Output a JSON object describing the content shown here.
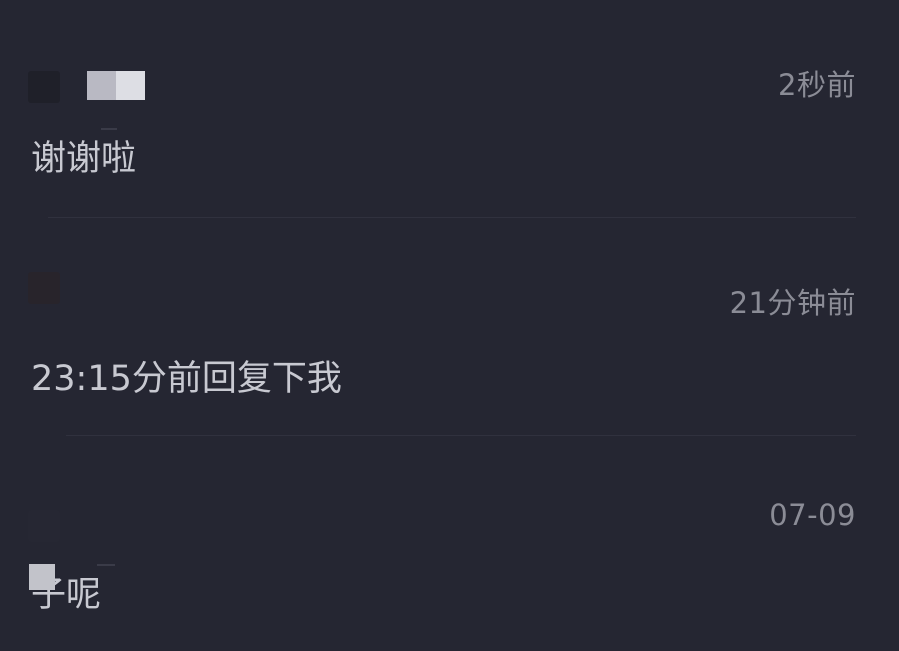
{
  "notifications": [
    {
      "time": "2秒前",
      "message": "谢谢啦"
    },
    {
      "time": "21分钟前",
      "message": "23:15分前回复下我"
    },
    {
      "time": "07-09",
      "message": "子呢"
    }
  ],
  "colors": {
    "background": "#252632",
    "time_text": "#8b8c96",
    "message_text": "#c8c9d1",
    "divider": "#30313e"
  }
}
